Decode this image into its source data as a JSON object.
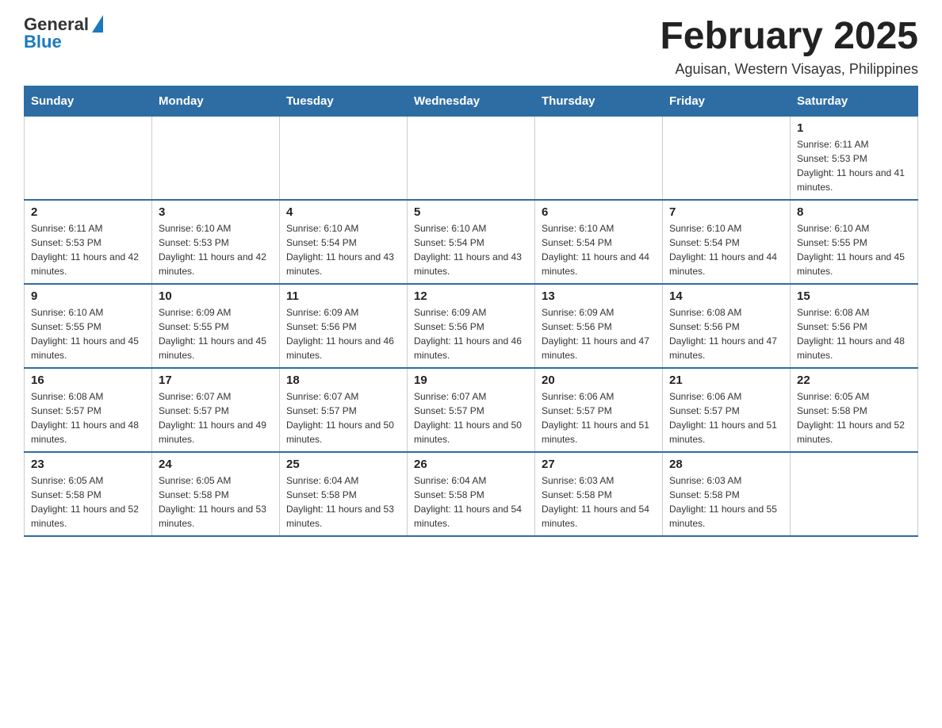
{
  "header": {
    "logo_general": "General",
    "logo_blue": "Blue",
    "month_title": "February 2025",
    "location": "Aguisan, Western Visayas, Philippines"
  },
  "days_of_week": [
    "Sunday",
    "Monday",
    "Tuesday",
    "Wednesday",
    "Thursday",
    "Friday",
    "Saturday"
  ],
  "weeks": [
    [
      {
        "day": "",
        "info": ""
      },
      {
        "day": "",
        "info": ""
      },
      {
        "day": "",
        "info": ""
      },
      {
        "day": "",
        "info": ""
      },
      {
        "day": "",
        "info": ""
      },
      {
        "day": "",
        "info": ""
      },
      {
        "day": "1",
        "info": "Sunrise: 6:11 AM\nSunset: 5:53 PM\nDaylight: 11 hours and 41 minutes."
      }
    ],
    [
      {
        "day": "2",
        "info": "Sunrise: 6:11 AM\nSunset: 5:53 PM\nDaylight: 11 hours and 42 minutes."
      },
      {
        "day": "3",
        "info": "Sunrise: 6:10 AM\nSunset: 5:53 PM\nDaylight: 11 hours and 42 minutes."
      },
      {
        "day": "4",
        "info": "Sunrise: 6:10 AM\nSunset: 5:54 PM\nDaylight: 11 hours and 43 minutes."
      },
      {
        "day": "5",
        "info": "Sunrise: 6:10 AM\nSunset: 5:54 PM\nDaylight: 11 hours and 43 minutes."
      },
      {
        "day": "6",
        "info": "Sunrise: 6:10 AM\nSunset: 5:54 PM\nDaylight: 11 hours and 44 minutes."
      },
      {
        "day": "7",
        "info": "Sunrise: 6:10 AM\nSunset: 5:54 PM\nDaylight: 11 hours and 44 minutes."
      },
      {
        "day": "8",
        "info": "Sunrise: 6:10 AM\nSunset: 5:55 PM\nDaylight: 11 hours and 45 minutes."
      }
    ],
    [
      {
        "day": "9",
        "info": "Sunrise: 6:10 AM\nSunset: 5:55 PM\nDaylight: 11 hours and 45 minutes."
      },
      {
        "day": "10",
        "info": "Sunrise: 6:09 AM\nSunset: 5:55 PM\nDaylight: 11 hours and 45 minutes."
      },
      {
        "day": "11",
        "info": "Sunrise: 6:09 AM\nSunset: 5:56 PM\nDaylight: 11 hours and 46 minutes."
      },
      {
        "day": "12",
        "info": "Sunrise: 6:09 AM\nSunset: 5:56 PM\nDaylight: 11 hours and 46 minutes."
      },
      {
        "day": "13",
        "info": "Sunrise: 6:09 AM\nSunset: 5:56 PM\nDaylight: 11 hours and 47 minutes."
      },
      {
        "day": "14",
        "info": "Sunrise: 6:08 AM\nSunset: 5:56 PM\nDaylight: 11 hours and 47 minutes."
      },
      {
        "day": "15",
        "info": "Sunrise: 6:08 AM\nSunset: 5:56 PM\nDaylight: 11 hours and 48 minutes."
      }
    ],
    [
      {
        "day": "16",
        "info": "Sunrise: 6:08 AM\nSunset: 5:57 PM\nDaylight: 11 hours and 48 minutes."
      },
      {
        "day": "17",
        "info": "Sunrise: 6:07 AM\nSunset: 5:57 PM\nDaylight: 11 hours and 49 minutes."
      },
      {
        "day": "18",
        "info": "Sunrise: 6:07 AM\nSunset: 5:57 PM\nDaylight: 11 hours and 50 minutes."
      },
      {
        "day": "19",
        "info": "Sunrise: 6:07 AM\nSunset: 5:57 PM\nDaylight: 11 hours and 50 minutes."
      },
      {
        "day": "20",
        "info": "Sunrise: 6:06 AM\nSunset: 5:57 PM\nDaylight: 11 hours and 51 minutes."
      },
      {
        "day": "21",
        "info": "Sunrise: 6:06 AM\nSunset: 5:57 PM\nDaylight: 11 hours and 51 minutes."
      },
      {
        "day": "22",
        "info": "Sunrise: 6:05 AM\nSunset: 5:58 PM\nDaylight: 11 hours and 52 minutes."
      }
    ],
    [
      {
        "day": "23",
        "info": "Sunrise: 6:05 AM\nSunset: 5:58 PM\nDaylight: 11 hours and 52 minutes."
      },
      {
        "day": "24",
        "info": "Sunrise: 6:05 AM\nSunset: 5:58 PM\nDaylight: 11 hours and 53 minutes."
      },
      {
        "day": "25",
        "info": "Sunrise: 6:04 AM\nSunset: 5:58 PM\nDaylight: 11 hours and 53 minutes."
      },
      {
        "day": "26",
        "info": "Sunrise: 6:04 AM\nSunset: 5:58 PM\nDaylight: 11 hours and 54 minutes."
      },
      {
        "day": "27",
        "info": "Sunrise: 6:03 AM\nSunset: 5:58 PM\nDaylight: 11 hours and 54 minutes."
      },
      {
        "day": "28",
        "info": "Sunrise: 6:03 AM\nSunset: 5:58 PM\nDaylight: 11 hours and 55 minutes."
      },
      {
        "day": "",
        "info": ""
      }
    ]
  ]
}
